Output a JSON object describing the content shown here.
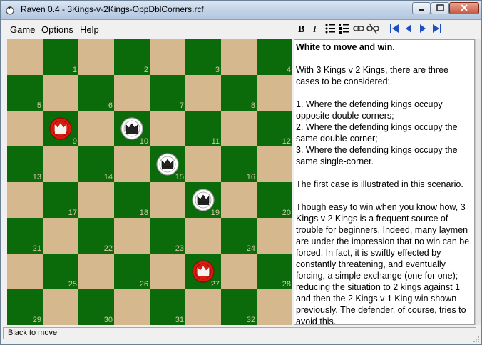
{
  "window": {
    "title": "Raven 0.4 - 3Kings-v-2Kings-OppDblCorners.rcf"
  },
  "menu": {
    "game": "Game",
    "options": "Options",
    "help": "Help"
  },
  "toolbar": {
    "icons": [
      "bold-icon",
      "italic-icon",
      "bullet-list-icon",
      "numbered-list-icon",
      "link-icon",
      "unlink-icon",
      "first-move-icon",
      "previous-move-icon",
      "next-move-icon",
      "last-move-icon"
    ]
  },
  "board": {
    "light_color": "#d6b88e",
    "dark_color": "#0b6b0b",
    "square_numbers": [
      "1",
      "2",
      "3",
      "4",
      "5",
      "6",
      "7",
      "8",
      "9",
      "10",
      "11",
      "12",
      "13",
      "14",
      "15",
      "16",
      "17",
      "18",
      "19",
      "20",
      "21",
      "22",
      "23",
      "24",
      "25",
      "26",
      "27",
      "28",
      "29",
      "30",
      "31",
      "32"
    ],
    "pieces": [
      {
        "square": 9,
        "color": "red",
        "type": "king"
      },
      {
        "square": 10,
        "color": "white",
        "type": "king"
      },
      {
        "square": 15,
        "color": "white",
        "type": "king"
      },
      {
        "square": 19,
        "color": "white",
        "type": "king"
      },
      {
        "square": 27,
        "color": "red",
        "type": "king"
      }
    ]
  },
  "text_panel": {
    "heading": "White to move and win.",
    "p1": "With 3 Kings v 2 Kings, there are three cases to be considered:",
    "case1": "1. Where the defending kings occupy opposite double-corners;",
    "case2": "2. Where the defending kings occupy the same double-corner;",
    "case3": "3. Where the defending kings occupy the same single-corner.",
    "p3": "The first case is illustrated in this scenario.",
    "p4": "Though easy to win when you know how, 3 Kings v 2 Kings is a frequent source of trouble for beginners. Indeed, many laymen are under the impression that no win can be forced. In fact, it is swiftly effected by constantly threatening, and eventually forcing, a simple exchange (one for one); reducing the situation to 2 kings against 1 and then the 2 Kings v 1 King win shown previously. The defender, of course, tries to avoid this."
  },
  "status": {
    "text": "Black to move"
  }
}
